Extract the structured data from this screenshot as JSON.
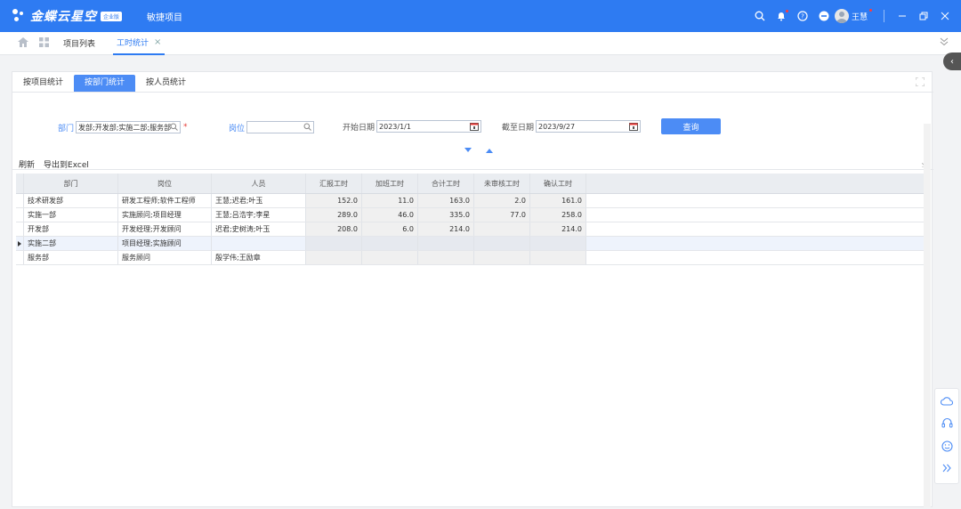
{
  "app": {
    "brand": "金蝶云星空",
    "badge": "企业版",
    "title": "敏捷项目",
    "user": "王慧"
  },
  "tabs": {
    "project_list": "项目列表",
    "active": "工时统计",
    "close": "×"
  },
  "subtabs": [
    "按项目统计",
    "按部门统计",
    "按人员统计"
  ],
  "filters": {
    "dept_label": "部门",
    "dept_value": "发部;开发部;实施二部;服务部",
    "pos_label": "岗位",
    "pos_value": "",
    "start_label": "开始日期",
    "start_value": "2023/1/1",
    "end_label": "截至日期",
    "end_value": "2023/9/27",
    "required_mark": "*",
    "query_label": "查询"
  },
  "toolbar": {
    "refresh": "刷新",
    "export": "导出到Excel"
  },
  "table": {
    "columns": [
      "部门",
      "岗位",
      "人员",
      "汇报工时",
      "加班工时",
      "合计工时",
      "未审核工时",
      "确认工时"
    ],
    "rows": [
      [
        "技术研发部",
        "研发工程师;软件工程师",
        "王慧;迟君;叶玉",
        "152.0",
        "11.0",
        "163.0",
        "2.0",
        "161.0"
      ],
      [
        "实施一部",
        "实施顾问;项目经理",
        "王慧;吕浩宇;李星",
        "289.0",
        "46.0",
        "335.0",
        "77.0",
        "258.0"
      ],
      [
        "开发部",
        "开发经理;开发顾问",
        "迟君;史树涛;叶玉",
        "208.0",
        "6.0",
        "214.0",
        "",
        "214.0"
      ],
      [
        "实施二部",
        "项目经理;实施顾问",
        "",
        "",
        "",
        "",
        "",
        ""
      ],
      [
        "服务部",
        "服务顾问",
        "殷学伟;王励章",
        "",
        "",
        "",
        "",
        ""
      ]
    ],
    "selected_row": 3
  },
  "colors": {
    "primary": "#2e7bf2",
    "accent": "#4c8cf5",
    "required": "#e53935"
  }
}
